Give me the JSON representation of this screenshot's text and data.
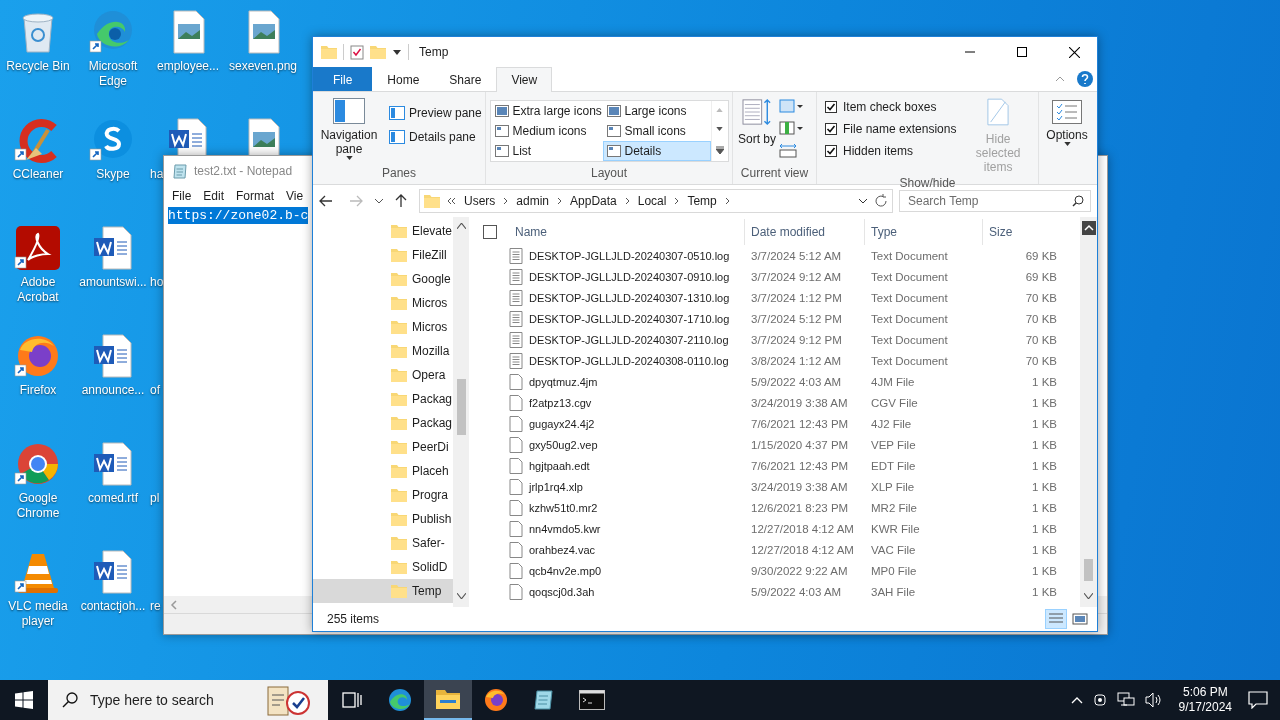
{
  "desktop": {
    "columns": [
      [
        {
          "label": "Recycle Bin",
          "kind": "recycle",
          "shortcut": false
        },
        {
          "label": "CCleaner",
          "kind": "ccleaner",
          "shortcut": true
        },
        {
          "label": "Adobe Acrobat",
          "kind": "acrobat",
          "shortcut": true
        },
        {
          "label": "Firefox",
          "kind": "firefox",
          "shortcut": true
        },
        {
          "label": "Google Chrome",
          "kind": "chrome",
          "shortcut": true
        },
        {
          "label": "VLC media player",
          "kind": "vlc",
          "shortcut": true
        }
      ],
      [
        {
          "label": "Microsoft Edge",
          "kind": "edge",
          "shortcut": true
        },
        {
          "label": "Skype",
          "kind": "skype",
          "shortcut": true
        },
        {
          "label": "amountswi...",
          "kind": "word",
          "shortcut": false
        },
        {
          "label": "announce...",
          "kind": "word",
          "shortcut": false
        },
        {
          "label": "comed.rtf",
          "kind": "word",
          "shortcut": false
        },
        {
          "label": "contactjoh...",
          "kind": "word",
          "shortcut": false
        }
      ],
      [
        {
          "label": "employee...",
          "kind": "image",
          "shortcut": false
        },
        {
          "label": "ha",
          "kind": "word",
          "shortcut": false,
          "cut": true
        },
        {
          "label": "ho",
          "cut": true
        },
        {
          "label": "of",
          "cut": true
        },
        {
          "label": "pl",
          "cut": true
        },
        {
          "label": "re",
          "cut": true
        }
      ],
      [
        {
          "label": "sexeven.png",
          "kind": "image",
          "shortcut": false
        },
        {
          "kind": "image",
          "shortcut": false
        }
      ]
    ]
  },
  "notepad": {
    "title": "test2.txt - Notepad",
    "menu": [
      "File",
      "Edit",
      "Format",
      "Vie"
    ],
    "text": "https://zone02.b-c",
    "selected": true
  },
  "explorer": {
    "title": "Temp",
    "tabs": [
      {
        "label": "File",
        "kind": "file",
        "selected": false
      },
      {
        "label": "Home",
        "kind": "tab",
        "selected": false
      },
      {
        "label": "Share",
        "kind": "tab",
        "selected": false
      },
      {
        "label": "View",
        "kind": "tab",
        "selected": true
      }
    ],
    "panes_group": {
      "title": "Panes",
      "navigation_pane": "Navigation pane",
      "buttons": [
        "Preview pane",
        "Details pane"
      ]
    },
    "layout_group": {
      "title": "Layout",
      "options": [
        {
          "label": "Extra large icons",
          "selected": false
        },
        {
          "label": "Large icons",
          "selected": false
        },
        {
          "label": "Medium icons",
          "selected": false
        },
        {
          "label": "Small icons",
          "selected": false
        },
        {
          "label": "List",
          "selected": false
        },
        {
          "label": "Details",
          "selected": true
        }
      ]
    },
    "current_view_group": {
      "title": "Current view",
      "sort_by": "Sort by"
    },
    "show_hide_group": {
      "title": "Show/hide",
      "checkboxes": [
        {
          "label": "Item check boxes",
          "checked": true
        },
        {
          "label": "File name extensions",
          "checked": true
        },
        {
          "label": "Hidden items",
          "checked": true
        }
      ],
      "hide_selected": {
        "label": "Hide selected items",
        "disabled": true
      }
    },
    "options": {
      "label": "Options"
    },
    "address": {
      "crumbs": [
        "Users",
        "admin",
        "AppData",
        "Local",
        "Temp"
      ]
    },
    "search": {
      "placeholder": "Search Temp"
    },
    "nav_items": [
      {
        "label": "Elevate",
        "selected": false
      },
      {
        "label": "FileZill",
        "selected": false
      },
      {
        "label": "Google",
        "selected": false
      },
      {
        "label": "Micros",
        "selected": false
      },
      {
        "label": "Micros",
        "selected": false
      },
      {
        "label": "Mozilla",
        "selected": false
      },
      {
        "label": "Opera",
        "selected": false
      },
      {
        "label": "Packag",
        "selected": false
      },
      {
        "label": "Packag",
        "selected": false
      },
      {
        "label": "PeerDi",
        "selected": false
      },
      {
        "label": "Placeh",
        "selected": false
      },
      {
        "label": "Progra",
        "selected": false
      },
      {
        "label": "Publish",
        "selected": false
      },
      {
        "label": "Safer-",
        "selected": false
      },
      {
        "label": "SolidD",
        "selected": false
      },
      {
        "label": "Temp",
        "selected": true
      }
    ],
    "select_all": {
      "checked": false
    },
    "columns": [
      "Name",
      "Date modified",
      "Type",
      "Size"
    ],
    "rows": [
      {
        "name": "DESKTOP-JGLLJLD-20240307-0510.log",
        "date": "3/7/2024 5:12 AM",
        "type": "Text Document",
        "size": "69 KB",
        "kind": "text"
      },
      {
        "name": "DESKTOP-JGLLJLD-20240307-0910.log",
        "date": "3/7/2024 9:12 AM",
        "type": "Text Document",
        "size": "69 KB",
        "kind": "text"
      },
      {
        "name": "DESKTOP-JGLLJLD-20240307-1310.log",
        "date": "3/7/2024 1:12 PM",
        "type": "Text Document",
        "size": "70 KB",
        "kind": "text"
      },
      {
        "name": "DESKTOP-JGLLJLD-20240307-1710.log",
        "date": "3/7/2024 5:12 PM",
        "type": "Text Document",
        "size": "70 KB",
        "kind": "text"
      },
      {
        "name": "DESKTOP-JGLLJLD-20240307-2110.log",
        "date": "3/7/2024 9:12 PM",
        "type": "Text Document",
        "size": "70 KB",
        "kind": "text"
      },
      {
        "name": "DESKTOP-JGLLJLD-20240308-0110.log",
        "date": "3/8/2024 1:12 AM",
        "type": "Text Document",
        "size": "70 KB",
        "kind": "text"
      },
      {
        "name": "dpyqtmuz.4jm",
        "date": "5/9/2022 4:03 AM",
        "type": "4JM File",
        "size": "1 KB",
        "kind": "blank"
      },
      {
        "name": "f2atpz13.cgv",
        "date": "3/24/2019 3:38 AM",
        "type": "CGV File",
        "size": "1 KB",
        "kind": "blank"
      },
      {
        "name": "gugayx24.4j2",
        "date": "7/6/2021 12:43 PM",
        "type": "4J2 File",
        "size": "1 KB",
        "kind": "blank"
      },
      {
        "name": "gxy50ug2.vep",
        "date": "1/15/2020 4:37 PM",
        "type": "VEP File",
        "size": "1 KB",
        "kind": "blank"
      },
      {
        "name": "hgjtpaah.edt",
        "date": "7/6/2021 12:43 PM",
        "type": "EDT File",
        "size": "1 KB",
        "kind": "blank"
      },
      {
        "name": "jrlp1rq4.xlp",
        "date": "3/24/2019 3:38 AM",
        "type": "XLP File",
        "size": "1 KB",
        "kind": "blank"
      },
      {
        "name": "kzhw51t0.mr2",
        "date": "12/6/2021 8:23 PM",
        "type": "MR2 File",
        "size": "1 KB",
        "kind": "blank"
      },
      {
        "name": "nn4vmdo5.kwr",
        "date": "12/27/2018 4:12 AM",
        "type": "KWR File",
        "size": "1 KB",
        "kind": "blank"
      },
      {
        "name": "orahbez4.vac",
        "date": "12/27/2018 4:12 AM",
        "type": "VAC File",
        "size": "1 KB",
        "kind": "blank"
      },
      {
        "name": "qcb4nv2e.mp0",
        "date": "9/30/2022 9:22 AM",
        "type": "MP0 File",
        "size": "1 KB",
        "kind": "blank"
      },
      {
        "name": "qoqscj0d.3ah",
        "date": "5/9/2022 4:03 AM",
        "type": "3AH File",
        "size": "1 KB",
        "kind": "blank"
      }
    ],
    "status": "255 items"
  },
  "taskbar": {
    "search_placeholder": "Type here to search",
    "apps": [
      {
        "kind": "taskview",
        "active": false
      },
      {
        "kind": "edge",
        "active": false
      },
      {
        "kind": "folder",
        "active": true
      },
      {
        "kind": "firefox",
        "active": false
      },
      {
        "kind": "notepad",
        "active": false
      },
      {
        "kind": "terminal",
        "active": false
      }
    ],
    "time": "5:06 PM",
    "date": "9/17/2024"
  }
}
